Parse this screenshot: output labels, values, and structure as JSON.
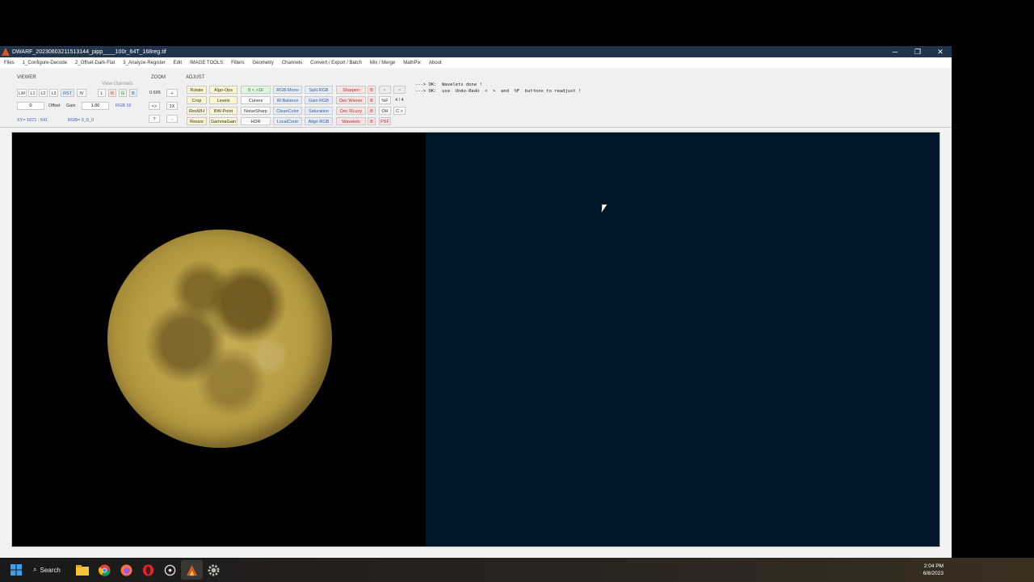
{
  "window": {
    "title": "DWARF_20230603211513144_pipp____100r_64T_168reg.tif",
    "minimize": "─",
    "restore": "❐",
    "close": "✕"
  },
  "menu": [
    "Files",
    "1_Configure-Decode",
    "2_Offset-Dark-Flat",
    "3_Analyze-Register",
    "Edit",
    "IMAGE TOOLS",
    "Filters",
    "Geometry",
    "Channels",
    "Convert / Export / Batch",
    "Mix / Merge",
    "MathPix",
    "About"
  ],
  "viewer": {
    "label": "VIEWER",
    "view_channels_label": "View channels",
    "buttons": [
      "LM",
      "L1",
      "L2",
      "L3",
      "RST",
      "IV"
    ],
    "channels": [
      "L",
      "R",
      "G",
      "B"
    ],
    "offset_value": "0",
    "offset_label": "Offset",
    "gain_label": "Gain",
    "gain_value": "1.00",
    "rgb_mode": "RGB 16",
    "xy_readout": "XY= 1071 : 541",
    "rgb_readout": "RGB= 0_0_0"
  },
  "zoom": {
    "label": "ZOOM",
    "value": "0.695",
    "plus": "+",
    "fit": "<>",
    "one_x": "1X",
    "help": "?",
    "minus": "-"
  },
  "adjust": {
    "label": "ADJUST",
    "row1": [
      "Rotate",
      "Algo-Ops",
      "8 < >16",
      "RGB-Mono",
      "Split RGB",
      "Sharpen",
      "B",
      "<",
      ">"
    ],
    "row2": [
      "Crop",
      "Levels",
      "Curves",
      "W-Balance",
      "Gain RGB",
      "Dec Wiener",
      "B",
      "%F",
      "4 / 4"
    ],
    "row3": [
      "ResWH",
      "BW-Point",
      "NoiseSharp",
      "CleanColor",
      "Saturation",
      "Dec RLucy",
      "B",
      "OH",
      "C >"
    ],
    "row4": [
      "Resize",
      "GammaGain",
      "HDR",
      "LocalContr",
      "Align RGB",
      "Wavelets",
      "B",
      "PSF"
    ]
  },
  "log": [
    "---> OK:  Wavelets done !",
    "---> OK:  use  Undo-Redo  <  >  and  %F  buttons to readjust !"
  ],
  "taskbar": {
    "search_label": "Search",
    "time": "2:04 PM",
    "date": "6/8/2023"
  }
}
